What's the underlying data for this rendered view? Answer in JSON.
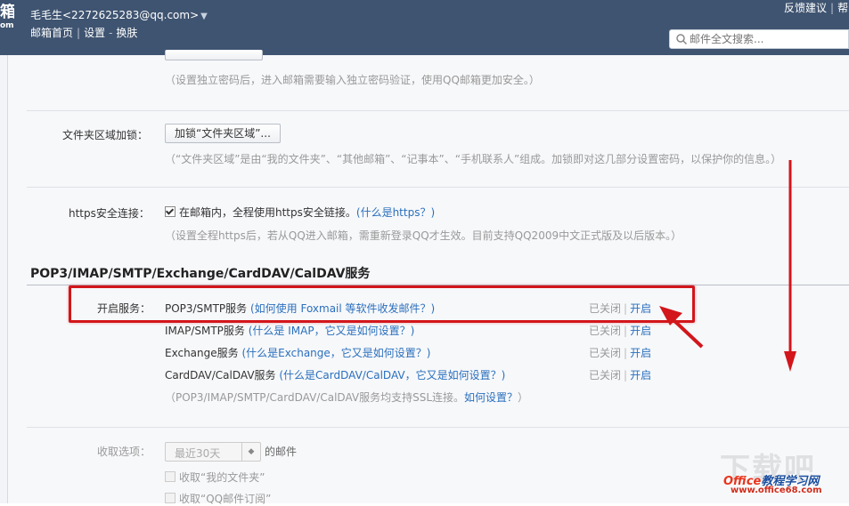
{
  "header": {
    "logo_char": "箱",
    "logo_sub": "om",
    "user": "毛毛生<2272625283@qq.com>",
    "nav": [
      "邮箱首页",
      "设置",
      "换肤"
    ],
    "nav_sep_1": "|",
    "nav_sep_2": "-",
    "top_links": [
      "反馈建议",
      "帮"
    ],
    "search_placeholder": "邮件全文搜索..."
  },
  "settings": {
    "password_hint": "（设置独立密码后，进入邮箱需要输入独立密码验证，使用QQ邮箱更加安全。）",
    "folder_lock": {
      "label": "文件夹区域加锁：",
      "button": "加锁“文件夹区域”...",
      "hint": "（“文件夹区域”是由“我的文件夹”、“其他邮箱”、“记事本”、“手机联系人”组成。加锁即对这几部分设置密码，以保护你的信息。）"
    },
    "https": {
      "label": "https安全连接：",
      "checked": true,
      "text": "在邮箱内，全程使用https安全链接。",
      "link": "(什么是https？)",
      "hint": "（设置全程https后，若从QQ进入邮箱，需重新登录QQ才生效。目前支持QQ2009中文正式版及以后版本。）"
    }
  },
  "services": {
    "title": "POP3/IMAP/SMTP/Exchange/CardDAV/CalDAV服务",
    "label": "开启服务：",
    "items": [
      {
        "name": "POP3/SMTP服务",
        "help": "(如何使用 Foxmail 等软件收发邮件？)",
        "status_off": "已关闭",
        "sep": "|",
        "action": "开启"
      },
      {
        "name": "IMAP/SMTP服务",
        "help": "(什么是 IMAP，它又是如何设置？)",
        "status_off": "已关闭",
        "sep": "|",
        "action": "开启"
      },
      {
        "name": "Exchange服务",
        "help": "(什么是Exchange，它又是如何设置？)",
        "status_off": "已关闭",
        "sep": "|",
        "action": "开启"
      },
      {
        "name": "CardDAV/CalDAV服务",
        "help": "(什么是CardDAV/CalDAV，它又是如何设置？)",
        "status_off": "已关闭",
        "sep": "|",
        "action": "开启"
      }
    ],
    "ssl_note": "（POP3/IMAP/SMTP/CardDAV/CalDAV服务均支持SSL连接。",
    "ssl_link": "如何设置？",
    "ssl_end": "）"
  },
  "receive": {
    "label": "收取选项：",
    "range": "最近30天",
    "suffix": "的邮件",
    "options": [
      "收取“我的文件夹”",
      "收取“QQ邮件订阅”"
    ]
  },
  "watermark": {
    "brand_a": "Office",
    "brand_b": "教程学习网",
    "url": "www.office68.com",
    "ghost": "下载吧"
  },
  "colors": {
    "header_bg": "#3f5471",
    "annotation": "#d2161b",
    "link": "#2a6fbd"
  }
}
